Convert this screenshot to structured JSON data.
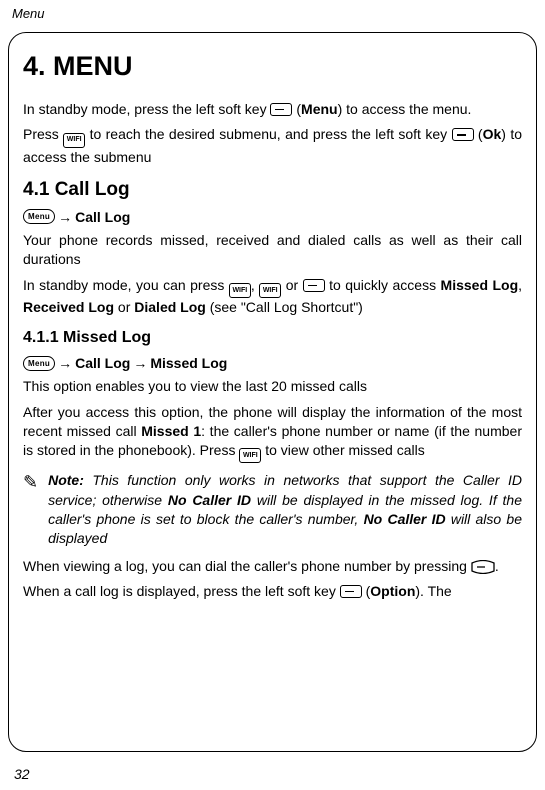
{
  "header": "Menu",
  "page_number": "32",
  "h1": "4. MENU",
  "intro": {
    "p1a": "In standby mode, press the left soft key ",
    "p1b": " (",
    "p1_menu": "Menu",
    "p1c": ") to access the menu.",
    "p2a": "Press ",
    "p2b": " to reach the desired submenu, and press the left soft key ",
    "p2c": " (",
    "p2_ok": "Ok",
    "p2d": ") to access the submenu"
  },
  "s41": {
    "heading": "4.1 Call Log",
    "crumb_menu": "Menu",
    "crumb_target": "Call Log",
    "p1": "Your phone records missed, received and dialed calls as well as their call durations",
    "p2a": "In standby mode, you can press ",
    "p2b": ", ",
    "p2c": " or ",
    "p2d": " to quickly access ",
    "p2_missed": "Missed Log",
    "p2_sep1": ", ",
    "p2_received": "Received Log",
    "p2_or": " or ",
    "p2_dialed": "Dialed Log",
    "p2e": " (see \"Call Log Shortcut\")"
  },
  "s411": {
    "heading": "4.1.1 Missed Log",
    "crumb_menu": "Menu",
    "crumb_mid": "Call Log",
    "crumb_target": "Missed Log",
    "p1": "This option enables you to view the last 20 missed calls",
    "p2a": "After you access this option, the phone will display the information of the most recent missed call ",
    "p2_missed1": "Missed 1",
    "p2b": ": the caller's phone number or name (if the number is stored in the phonebook). Press ",
    "p2c": " to view other missed calls",
    "note_label": "Note:",
    "note_a": " This function only works in networks that support the Caller ID service; otherwise ",
    "note_b1": "No Caller ID",
    "note_b": " will be displayed in the missed log. If the caller's phone is set to block the caller's number, ",
    "note_b2": "No Caller ID",
    "note_c": " will also be displayed",
    "p3a": "When viewing a log, you can dial the caller's phone number by pressing ",
    "p3b": ".",
    "p4a": "When a call log is displayed, press the left soft key ",
    "p4b": " (",
    "p4_option": "Option",
    "p4c": "). The"
  },
  "icons": {
    "wifi_label": "WIFI"
  }
}
